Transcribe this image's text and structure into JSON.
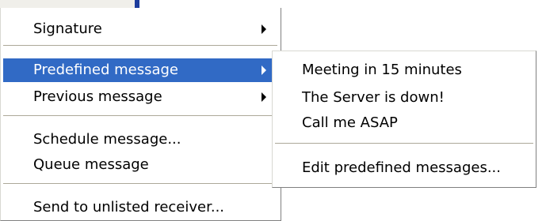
{
  "main_menu": {
    "items": [
      {
        "label": "Signature",
        "has_submenu": true
      },
      {
        "label": "Predefined message",
        "has_submenu": true,
        "highlighted": true
      },
      {
        "label": "Previous message",
        "has_submenu": true
      },
      {
        "label": "Schedule message..."
      },
      {
        "label": "Queue message"
      },
      {
        "label": "Send to unlisted receiver..."
      }
    ]
  },
  "submenu": {
    "items": [
      {
        "label": "Meeting in 15 minutes"
      },
      {
        "label": "The Server is down!"
      },
      {
        "label": "Call me ASAP"
      },
      {
        "label": "Edit predefined messages..."
      }
    ]
  },
  "colors": {
    "highlight_bg": "#316ac5",
    "highlight_text": "#ffffff",
    "menu_bg": "#ffffff",
    "separator": "#aca899"
  }
}
